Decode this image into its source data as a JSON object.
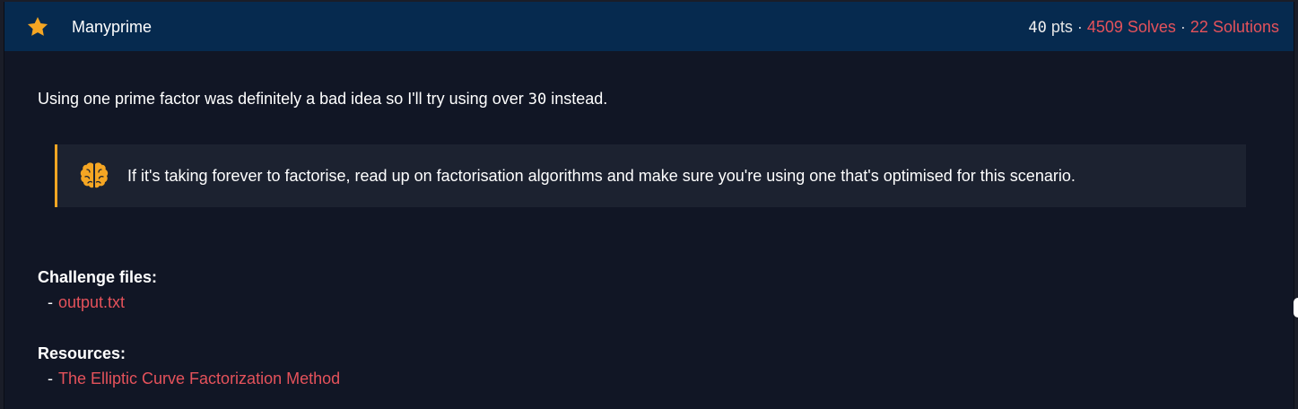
{
  "challenge": {
    "title": "Manyprime",
    "points": "40",
    "points_unit": "pts",
    "solves": "4509 Solves",
    "solutions": "22 Solutions",
    "separator": "·",
    "icon": "star-icon"
  },
  "description": {
    "before": "Using one prime factor was definitely a bad idea so I'll try using over ",
    "number": "30",
    "after": " instead."
  },
  "hint": {
    "icon": "brain-icon",
    "text": "If it's taking forever to factorise, read up on factorisation algorithms and make sure you're using one that's optimised for this scenario."
  },
  "files": {
    "heading": "Challenge files:",
    "items": [
      {
        "dash": "-",
        "label": "output.txt"
      }
    ]
  },
  "resources": {
    "heading": "Resources:",
    "items": [
      {
        "dash": "-",
        "label": "The Elliptic Curve Factorization Method"
      }
    ]
  },
  "colors": {
    "header_bg": "#062a4f",
    "body_bg": "#111625",
    "accent_link": "#e5525b",
    "hint_border": "#f5a623",
    "star": "#f5a623"
  }
}
